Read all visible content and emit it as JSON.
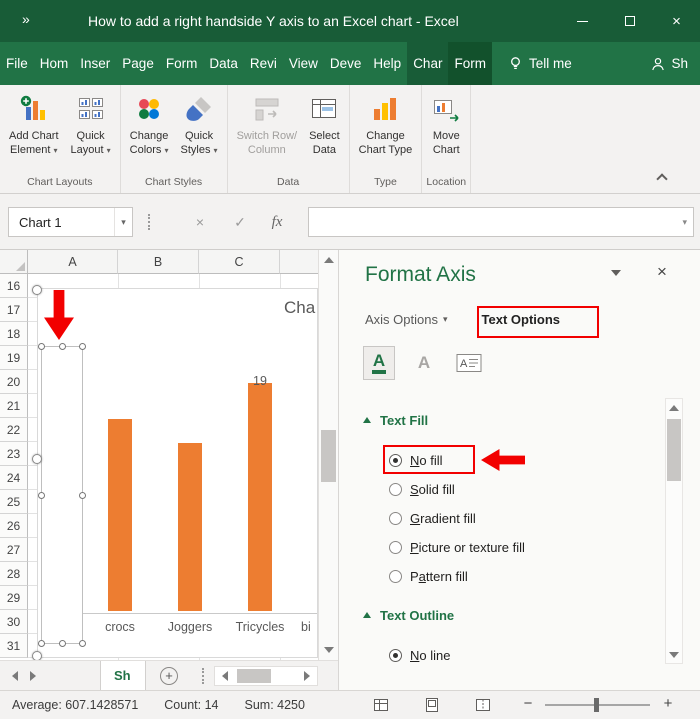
{
  "window": {
    "title": "How to add a right handside Y axis to an Excel chart  -  Excel"
  },
  "icons": {
    "quick_access_chevron": "»",
    "dropdown_chevron": "▾",
    "close": "×",
    "cancel": "×",
    "enter": "✓",
    "fx": "fx",
    "new_sheet": "+",
    "zoom_out": "−",
    "zoom_in": "+"
  },
  "ribbon": {
    "tabs": [
      {
        "label": "File"
      },
      {
        "label": "Hom"
      },
      {
        "label": "Inser"
      },
      {
        "label": "Page"
      },
      {
        "label": "Form"
      },
      {
        "label": "Data"
      },
      {
        "label": "Revi"
      },
      {
        "label": "View"
      },
      {
        "label": "Deve"
      },
      {
        "label": "Help"
      },
      {
        "label": "Char",
        "active": true,
        "contextual": true
      },
      {
        "label": "Form2",
        "display": "Form",
        "contextual": true
      }
    ],
    "tell_me": "Tell me",
    "share": "Sh",
    "groups": [
      {
        "name": "Chart Layouts",
        "buttons": [
          {
            "id": "add-chart-element",
            "lines": [
              "Add Chart",
              "Element"
            ],
            "dropdown": true,
            "icon": "add-chart-element-icon"
          },
          {
            "id": "quick-layout",
            "lines": [
              "Quick",
              "Layout"
            ],
            "dropdown": true,
            "icon": "quick-layout-icon"
          }
        ]
      },
      {
        "name": "Chart Styles",
        "buttons": [
          {
            "id": "change-colors",
            "lines": [
              "Change",
              "Colors"
            ],
            "dropdown": true,
            "icon": "change-colors-icon"
          },
          {
            "id": "quick-styles",
            "lines": [
              "Quick",
              "Styles"
            ],
            "dropdown": true,
            "icon": "quick-styles-icon"
          }
        ]
      },
      {
        "name": "Data",
        "buttons": [
          {
            "id": "switch-row-column",
            "lines": [
              "Switch Row/",
              "Column"
            ],
            "disabled": true,
            "icon": "switch-row-column-icon"
          },
          {
            "id": "select-data",
            "lines": [
              "Select",
              "Data"
            ],
            "icon": "select-data-icon"
          }
        ]
      },
      {
        "name": "Type",
        "buttons": [
          {
            "id": "change-chart-type",
            "lines": [
              "Change",
              "Chart Type"
            ],
            "icon": "change-chart-type-icon"
          }
        ]
      },
      {
        "name": "Location",
        "buttons": [
          {
            "id": "move-chart",
            "lines": [
              "Move",
              "Chart"
            ],
            "icon": "move-chart-icon"
          }
        ]
      }
    ]
  },
  "formula_bar": {
    "name_box": "Chart 1",
    "formula_value": ""
  },
  "worksheet": {
    "col_headers": [
      "A",
      "B",
      "C"
    ],
    "row_headers": [
      "16",
      "17",
      "18",
      "19",
      "20",
      "21",
      "22",
      "23",
      "24",
      "25",
      "26",
      "27",
      "28",
      "29",
      "30",
      "31"
    ]
  },
  "chart_data": {
    "type": "bar",
    "title_visible": "Cha",
    "categories": [
      "crocs",
      "Joggers",
      "Tricycles",
      "bi"
    ],
    "values": [
      16,
      14,
      19,
      null
    ],
    "visible_data_label": "19",
    "bar_color": "#ED7D31",
    "axis_text_hidden": true,
    "grid": false,
    "legend": false
  },
  "format_pane": {
    "title": "Format Axis",
    "tabs": [
      {
        "label": "Axis Options",
        "dropdown": true
      },
      {
        "label": "Text Options",
        "active": true,
        "annotated": true
      }
    ],
    "sections": [
      {
        "title": "Text Fill",
        "options": [
          {
            "label": "No fill",
            "key": "N",
            "selected": true,
            "annotated": true
          },
          {
            "label": "Solid fill",
            "key": "S"
          },
          {
            "label": "Gradient fill",
            "key": "G"
          },
          {
            "label": "Picture or texture fill",
            "key": "P"
          },
          {
            "label": "Pattern fill",
            "key": "a"
          }
        ]
      },
      {
        "title": "Text Outline",
        "options": [
          {
            "label": "No line",
            "key": "N",
            "selected": true
          }
        ]
      }
    ]
  },
  "sheet_tabs": {
    "active_tab": "Sh"
  },
  "status_bar": {
    "average": "Average: 607.1428571",
    "count": "Count: 14",
    "sum": "Sum: 4250"
  },
  "colors": {
    "excel_green": "#217346",
    "title_bar_green": "#185C37",
    "bar_orange": "#ED7D31",
    "annotation_red": "#F20000"
  }
}
